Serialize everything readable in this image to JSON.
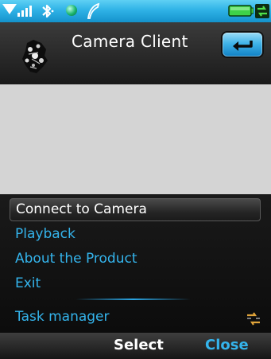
{
  "header": {
    "title": "Camera Client"
  },
  "menu": {
    "items": [
      {
        "label": "Connect to Camera",
        "selected": true
      },
      {
        "label": "Playback"
      },
      {
        "label": "About the Product"
      },
      {
        "label": "Exit"
      }
    ],
    "task_manager": "Task manager"
  },
  "softkeys": {
    "left": "",
    "center": "Select",
    "right": "Close"
  },
  "colors": {
    "accent": "#34b4ec",
    "status_bar": "#2fb2e6",
    "viewfinder": "#d4d4d4",
    "battery": "#3ed24a"
  },
  "icons": {
    "status": [
      "signal-triangle-icon",
      "signal-bars-icon",
      "bluetooth-icon",
      "ball-icon",
      "feather-icon",
      "battery-icon",
      "sync-icon"
    ],
    "header": [
      "app-logo-icon",
      "back-arrow-icon"
    ],
    "menu": [
      "task-manager-icon"
    ]
  }
}
